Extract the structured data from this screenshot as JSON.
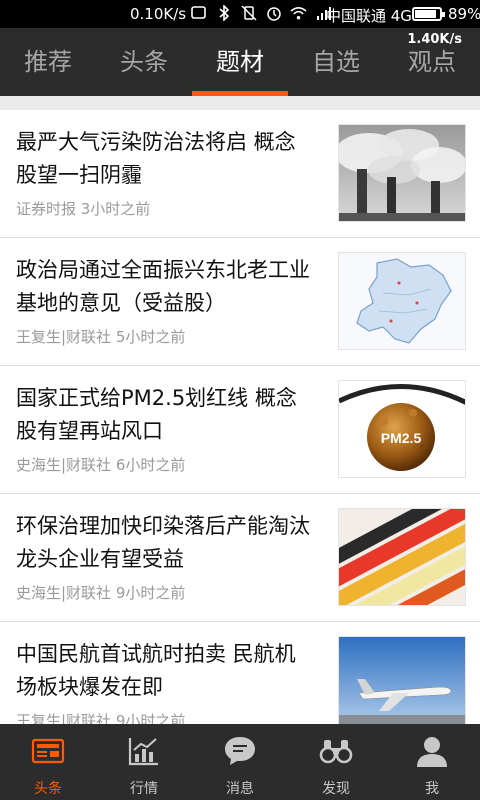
{
  "status_bar": {
    "speed": "0.10K/s",
    "carrier": "中国联通 4G",
    "battery": "89%",
    "battery_level": 0.89
  },
  "header": {
    "tabs": [
      "推荐",
      "头条",
      "题材",
      "自选",
      "观点"
    ],
    "active_tab": "题材",
    "speed_overlay": "1.40K/s"
  },
  "news": [
    {
      "title": "最严大气污染防治法将启 概念股望一扫阴霾",
      "meta": "证券时报 3小时之前"
    },
    {
      "title": "政治局通过全面振兴东北老工业基地的意见（受益股）",
      "meta": "王复生|财联社 5小时之前"
    },
    {
      "title": "国家正式给PM2.5划红线 概念股有望再站风口",
      "meta": "史海生|财联社 6小时之前"
    },
    {
      "title": "环保治理加快印染落后产能淘汰 龙头企业有望受益",
      "meta": "史海生|财联社 9小时之前"
    },
    {
      "title": "中国民航首试航时拍卖 民航机场板块爆发在即",
      "meta": "王复生|财联社 9小时之前"
    }
  ],
  "thumb_text": {
    "pm25": "PM2.5"
  },
  "bottom_nav": [
    {
      "label": "头条",
      "icon": "newspaper-icon"
    },
    {
      "label": "行情",
      "icon": "chart-icon"
    },
    {
      "label": "消息",
      "icon": "chat-bubble-icon"
    },
    {
      "label": "发现",
      "icon": "binoculars-icon"
    },
    {
      "label": "我",
      "icon": "user-icon"
    }
  ],
  "colors": {
    "accent": "#ff5a00",
    "bar_bg": "#2c2c2c"
  }
}
